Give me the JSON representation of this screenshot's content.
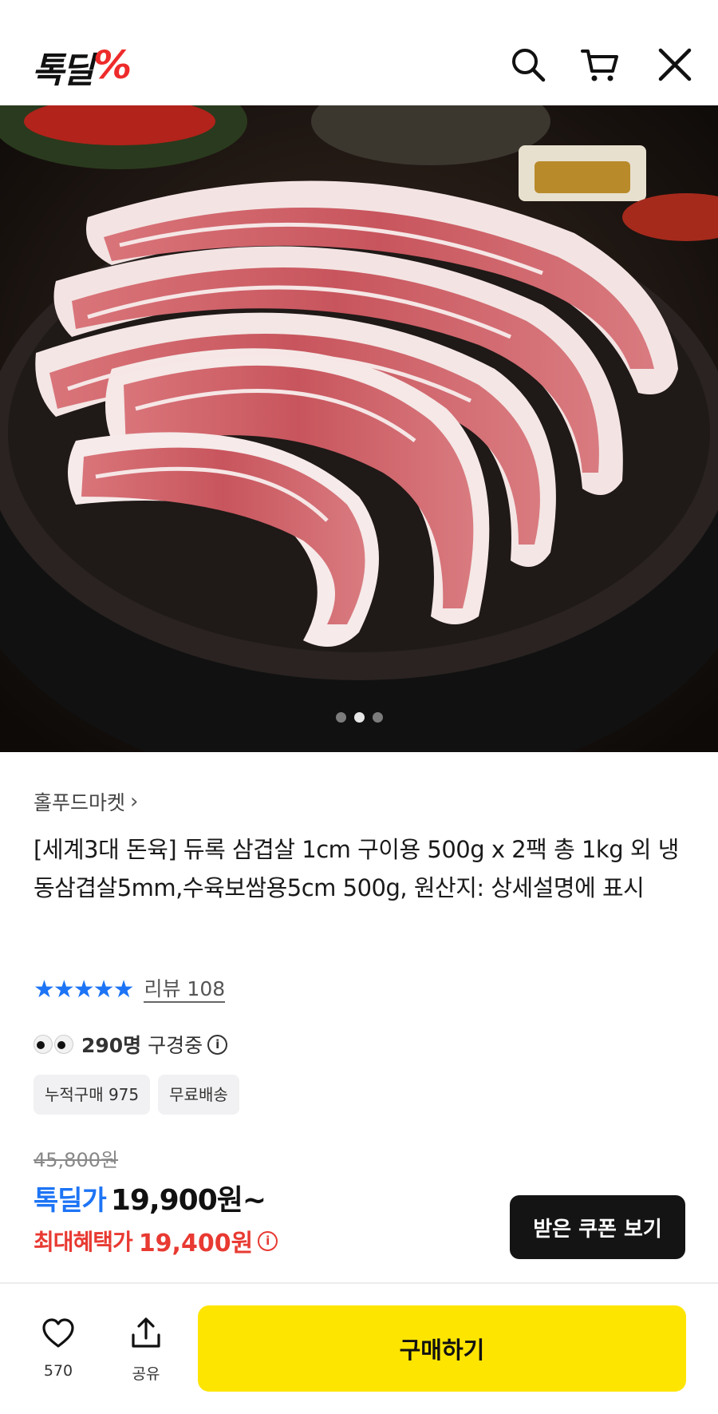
{
  "header": {
    "logo_text": "톡딜",
    "logo_symbol": "%",
    "icons": [
      "search-icon",
      "cart-icon",
      "close-icon"
    ]
  },
  "carousel": {
    "slides": 3,
    "active_index": 2
  },
  "product": {
    "seller": "홀푸드마켓",
    "title": "[세계3대 돈육] 듀록 삼겹살 1cm 구이용 500g x 2팩 총 1kg 외 냉동삼겹살5mm,수육보쌈용5cm 500g, 원산지: 상세설명에 표시",
    "rating_stars": "★★★★★",
    "review_label": "리뷰 108",
    "viewers_count": "290명",
    "viewers_label": "구경중",
    "badges": [
      "누적구매 975",
      "무료배송"
    ],
    "original_price": "45,800원",
    "deal_label": "톡딜가",
    "deal_price": "19,900원~",
    "max_benefit_label": "최대혜택가",
    "max_benefit_price": "19,400원",
    "info_symbol": "i"
  },
  "coupon_button": "받은 쿠폰 보기",
  "bottom_bar": {
    "like_count": "570",
    "share_label": "공유",
    "buy_label": "구매하기"
  },
  "colors": {
    "accent_blue": "#1d74f5",
    "accent_red": "#e83a32",
    "buy_yellow": "#fee500",
    "logo_red": "#ee2b2b"
  }
}
